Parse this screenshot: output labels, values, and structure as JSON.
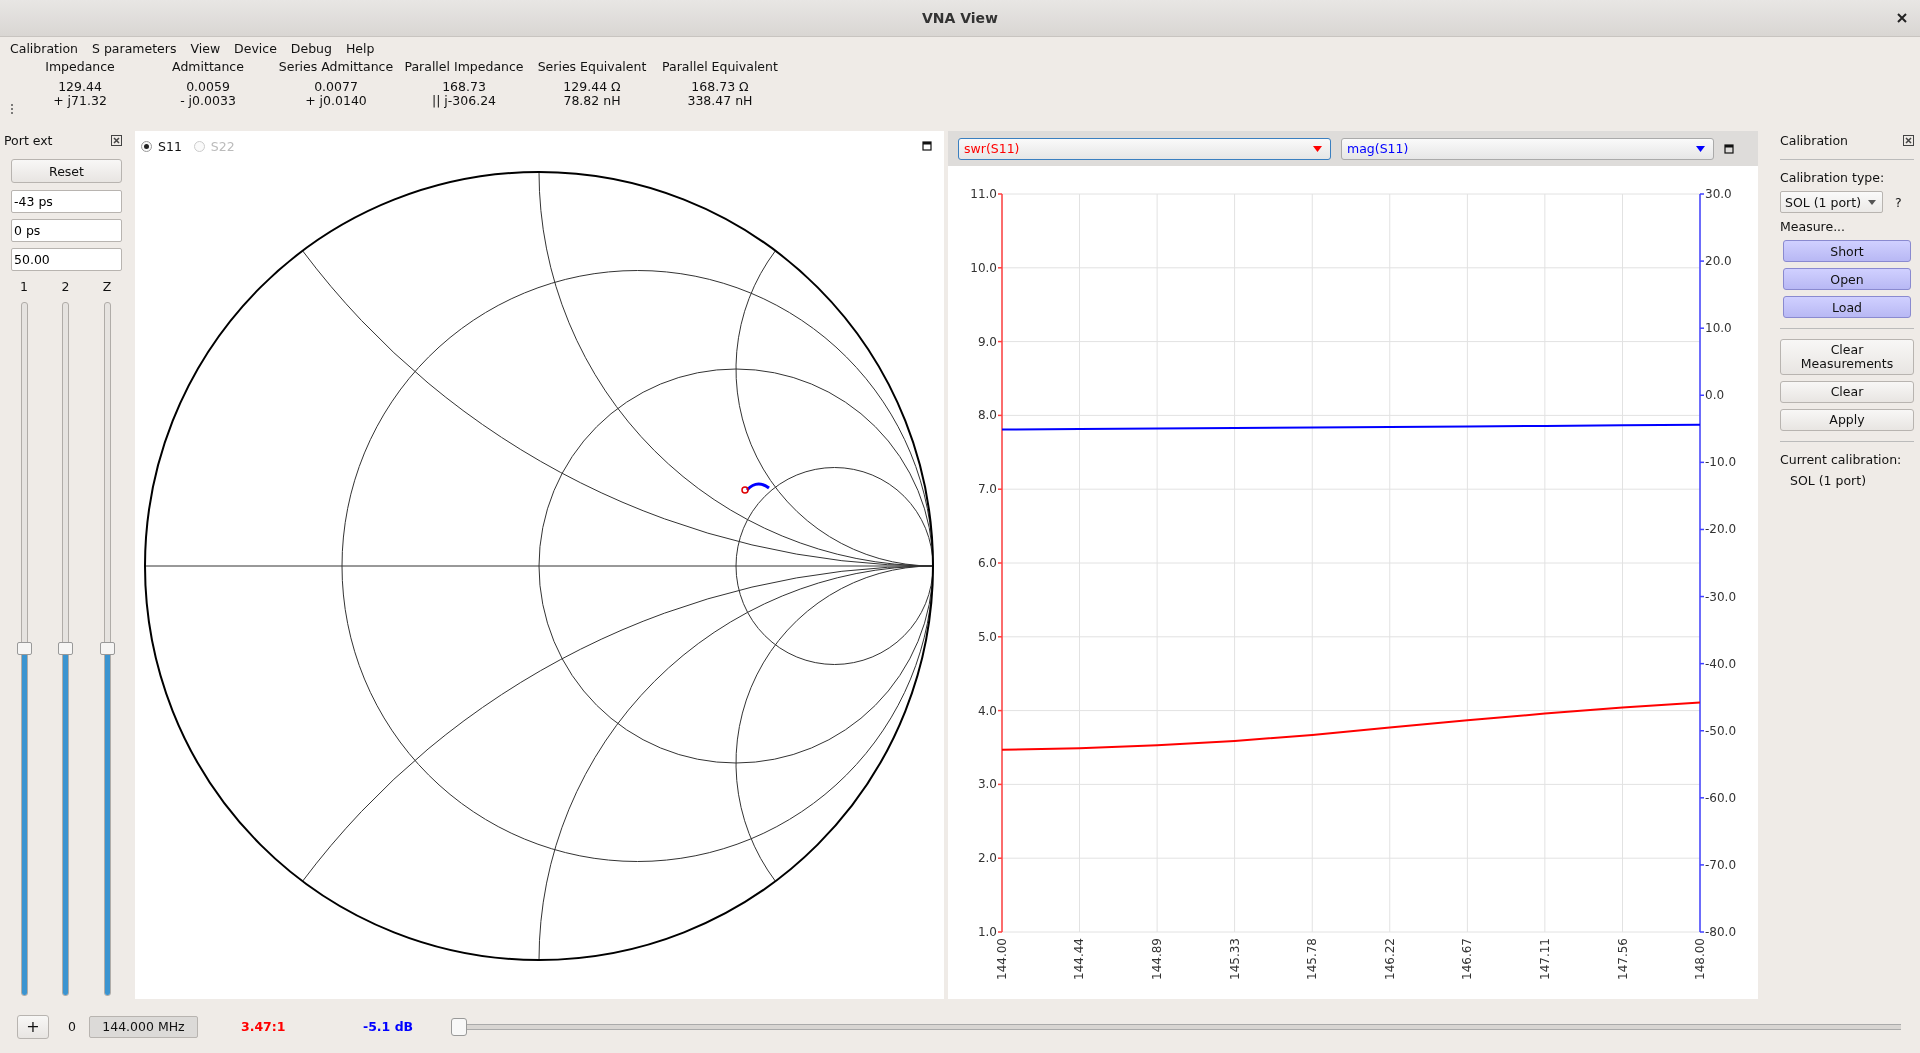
{
  "window": {
    "title": "VNA View"
  },
  "menu": [
    "Calibration",
    "S parameters",
    "View",
    "Device",
    "Debug",
    "Help"
  ],
  "readouts": [
    {
      "label": "Impedance",
      "line_1": "129.44",
      "line_2": "+ j71.32"
    },
    {
      "label": "Admittance",
      "line_1": "0.0059",
      "line_2": "- j0.0033"
    },
    {
      "label": "Series Admittance",
      "line_1": "0.0077",
      "line_2": "+ j0.0140"
    },
    {
      "label": "Parallel Impedance",
      "line_1": "168.73",
      "line_2": "|| j-306.24"
    },
    {
      "label": "Series Equivalent",
      "line_1": "129.44 Ω",
      "line_2": "78.82 nH"
    },
    {
      "label": "Parallel Equivalent",
      "line_1": "168.73 Ω",
      "line_2": "338.47 nH"
    }
  ],
  "port_ext": {
    "title": "Port ext",
    "reset": "Reset",
    "fields": [
      "-43 ps",
      "0 ps",
      "50.00"
    ],
    "sliders": [
      {
        "label": "1",
        "level": 0.5
      },
      {
        "label": "2",
        "level": 0.5
      },
      {
        "label": "Z",
        "level": 0.5
      }
    ]
  },
  "smith": {
    "ports": [
      {
        "label": "S11",
        "selected": true,
        "disabled": false
      },
      {
        "label": "S22",
        "selected": false,
        "disabled": true
      }
    ]
  },
  "graph": {
    "chart_data": {
      "type": "line",
      "grid": true,
      "x": [
        144,
        144.444,
        144.889,
        145.333,
        145.778,
        146.222,
        146.667,
        147.111,
        147.556,
        148
      ],
      "xlim": [
        144,
        148
      ],
      "xticks": [
        {
          "value": 144,
          "label": "144.00"
        },
        {
          "value": 144.444,
          "label": "144.44"
        },
        {
          "value": 144.889,
          "label": "144.89"
        },
        {
          "value": 145.333,
          "label": "145.33"
        },
        {
          "value": 145.778,
          "label": "145.78"
        },
        {
          "value": 146.222,
          "label": "146.22"
        },
        {
          "value": 146.667,
          "label": "146.67"
        },
        {
          "value": 147.111,
          "label": "147.11"
        },
        {
          "value": 147.556,
          "label": "147.56"
        },
        {
          "value": 148,
          "label": "148.00"
        }
      ],
      "ylim": [
        1,
        11
      ],
      "yticks": [
        {
          "value": 1,
          "label": "1.0"
        },
        {
          "value": 2,
          "label": "2.0"
        },
        {
          "value": 3,
          "label": "3.0"
        },
        {
          "value": 4,
          "label": "4.0"
        },
        {
          "value": 5,
          "label": "5.0"
        },
        {
          "value": 6,
          "label": "6.0"
        },
        {
          "value": 7,
          "label": "7.0"
        },
        {
          "value": 8,
          "label": "8.0"
        },
        {
          "value": 9,
          "label": "9.0"
        },
        {
          "value": 10,
          "label": "10.0"
        },
        {
          "value": 11,
          "label": "11.0"
        }
      ],
      "y2lim": [
        -80,
        30
      ],
      "y2ticks": [
        {
          "value": 30,
          "label": "30.0"
        },
        {
          "value": 20,
          "label": "20.0"
        },
        {
          "value": 10,
          "label": "10.0"
        },
        {
          "value": 0,
          "label": "0.0"
        },
        {
          "value": -10,
          "label": "-10.0"
        },
        {
          "value": -20,
          "label": "-20.0"
        },
        {
          "value": -30,
          "label": "-30.0"
        },
        {
          "value": -40,
          "label": "-40.0"
        },
        {
          "value": -50,
          "label": "-50.0"
        },
        {
          "value": -60,
          "label": "-60.0"
        },
        {
          "value": -70,
          "label": "-70.0"
        },
        {
          "value": -80,
          "label": "-80.0"
        }
      ],
      "series": [
        {
          "name": "swr(S11)",
          "color": "#ff0000",
          "values": [
            3.47,
            3.49,
            3.53,
            3.59,
            3.67,
            3.77,
            3.87,
            3.96,
            4.04,
            4.11
          ]
        },
        {
          "name": "mag(S11)",
          "color": "#0000ff",
          "axis": "y2",
          "values": [
            -5.1,
            -5.03,
            -4.95,
            -4.87,
            -4.8,
            -4.72,
            -4.64,
            -4.56,
            -4.48,
            -4.4
          ]
        }
      ]
    }
  },
  "calibration": {
    "title": "Calibration",
    "type_label": "Calibration type:",
    "type_value": "SOL (1 port)",
    "help": "?",
    "measure_label": "Measure...",
    "measure_buttons": [
      {
        "label": "Short",
        "measured": true
      },
      {
        "label": "Open",
        "measured": true
      },
      {
        "label": "Load",
        "measured": true
      }
    ],
    "actions": [
      "Clear\nMeasurements",
      "Clear",
      "Apply"
    ],
    "current_label": "Current calibration:",
    "current_value": "SOL (1 port)"
  },
  "bottom": {
    "add": "+",
    "marker_index": "0",
    "frequency": "144.000 MHz",
    "swr": "3.47:1",
    "magnitude": "-5.1 dB",
    "slider": {
      "level": 0
    }
  }
}
